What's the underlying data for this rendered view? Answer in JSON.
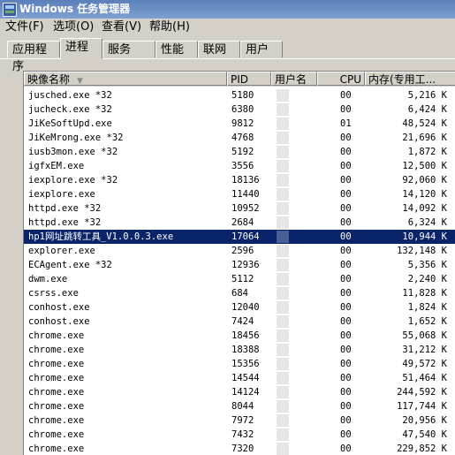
{
  "window": {
    "title": "Windows 任务管理器"
  },
  "menu": [
    "文件(F)",
    "选项(O)",
    "查看(V)",
    "帮助(H)"
  ],
  "tabs": [
    "应用程序",
    "进程",
    "服务",
    "性能",
    "联网",
    "用户"
  ],
  "active_tab": "进程",
  "columns": {
    "name": "映像名称",
    "pid": "PID",
    "user": "用户名",
    "cpu": "CPU",
    "mem": "内存(专用工..."
  },
  "selected_index": 10,
  "rows": [
    {
      "name": "jusched.exe *32",
      "pid": "5180",
      "cpu": "00",
      "mem": "5,216 K"
    },
    {
      "name": "jucheck.exe *32",
      "pid": "6380",
      "cpu": "00",
      "mem": "6,424 K"
    },
    {
      "name": "JiKeSoftUpd.exe",
      "pid": "9812",
      "cpu": "01",
      "mem": "48,524 K"
    },
    {
      "name": "JiKeMrong.exe *32",
      "pid": "4768",
      "cpu": "00",
      "mem": "21,696 K"
    },
    {
      "name": "iusb3mon.exe *32",
      "pid": "5192",
      "cpu": "00",
      "mem": "1,872 K"
    },
    {
      "name": "igfxEM.exe",
      "pid": "3556",
      "cpu": "00",
      "mem": "12,500 K"
    },
    {
      "name": "iexplore.exe *32",
      "pid": "18136",
      "cpu": "00",
      "mem": "92,060 K"
    },
    {
      "name": "iexplore.exe",
      "pid": "11440",
      "cpu": "00",
      "mem": "14,120 K"
    },
    {
      "name": "httpd.exe *32",
      "pid": "10952",
      "cpu": "00",
      "mem": "14,092 K"
    },
    {
      "name": "httpd.exe *32",
      "pid": "2684",
      "cpu": "00",
      "mem": "6,324 K"
    },
    {
      "name": "hp1网址跳转工具_V1.0.0.3.exe",
      "pid": "17064",
      "cpu": "00",
      "mem": "10,944 K"
    },
    {
      "name": "explorer.exe",
      "pid": "2596",
      "cpu": "00",
      "mem": "132,148 K"
    },
    {
      "name": "ECAgent.exe *32",
      "pid": "12936",
      "cpu": "00",
      "mem": "5,356 K"
    },
    {
      "name": "dwm.exe",
      "pid": "5112",
      "cpu": "00",
      "mem": "2,240 K"
    },
    {
      "name": "csrss.exe",
      "pid": "684",
      "cpu": "00",
      "mem": "11,828 K"
    },
    {
      "name": "conhost.exe",
      "pid": "12040",
      "cpu": "00",
      "mem": "1,824 K"
    },
    {
      "name": "conhost.exe",
      "pid": "7424",
      "cpu": "00",
      "mem": "1,652 K"
    },
    {
      "name": "chrome.exe",
      "pid": "18456",
      "cpu": "00",
      "mem": "55,068 K"
    },
    {
      "name": "chrome.exe",
      "pid": "18388",
      "cpu": "00",
      "mem": "31,212 K"
    },
    {
      "name": "chrome.exe",
      "pid": "15356",
      "cpu": "00",
      "mem": "49,572 K"
    },
    {
      "name": "chrome.exe",
      "pid": "14544",
      "cpu": "00",
      "mem": "51,464 K"
    },
    {
      "name": "chrome.exe",
      "pid": "14124",
      "cpu": "00",
      "mem": "244,592 K"
    },
    {
      "name": "chrome.exe",
      "pid": "8044",
      "cpu": "00",
      "mem": "117,744 K"
    },
    {
      "name": "chrome.exe",
      "pid": "7972",
      "cpu": "00",
      "mem": "20,956 K"
    },
    {
      "name": "chrome.exe",
      "pid": "7432",
      "cpu": "00",
      "mem": "47,540 K"
    },
    {
      "name": "chrome.exe",
      "pid": "7320",
      "cpu": "00",
      "mem": "229,852 K"
    }
  ]
}
